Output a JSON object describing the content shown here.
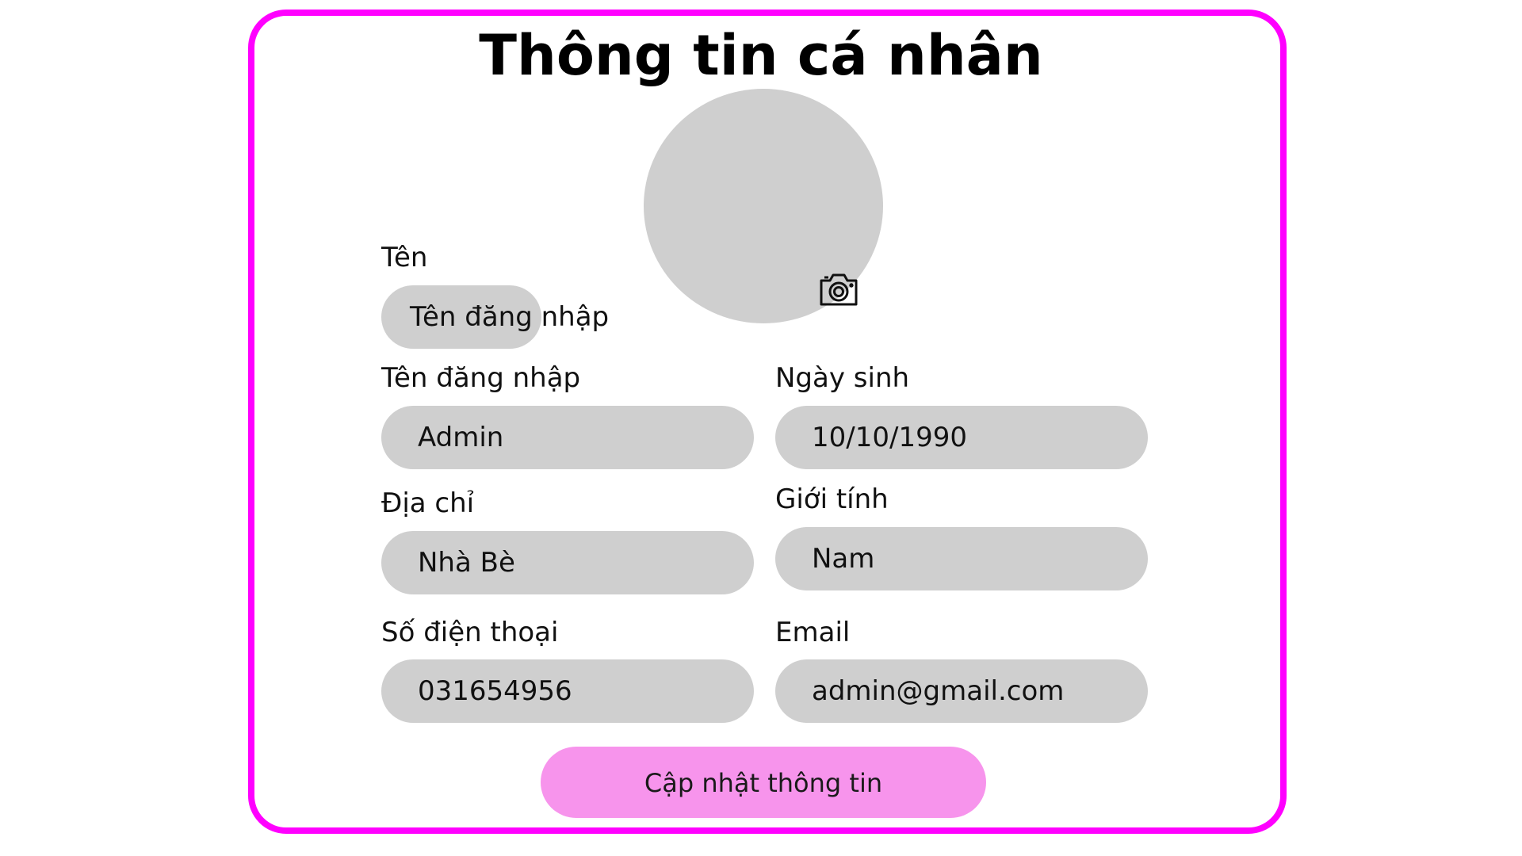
{
  "page": {
    "title": "Thông tin cá nhân"
  },
  "avatar": {
    "icon": "camera-icon"
  },
  "form": {
    "name": {
      "label": "Tên",
      "value": "Tên đăng nhập"
    },
    "username": {
      "label": "Tên đăng nhập",
      "value": "Admin"
    },
    "birthday": {
      "label": "Ngày sinh",
      "value": "10/10/1990"
    },
    "address": {
      "label": "Địa chỉ",
      "value": "Nhà Bè"
    },
    "gender": {
      "label": "Giới tính",
      "value": "Nam"
    },
    "phone": {
      "label": "Số điện thoại",
      "value": "031654956"
    },
    "email": {
      "label": "Email",
      "value": "admin@gmail.com"
    }
  },
  "actions": {
    "update_label": "Cập nhật thông tin"
  },
  "colors": {
    "border": "#ff00ff",
    "field": "#cfcfcf",
    "button": "#f794ec"
  }
}
